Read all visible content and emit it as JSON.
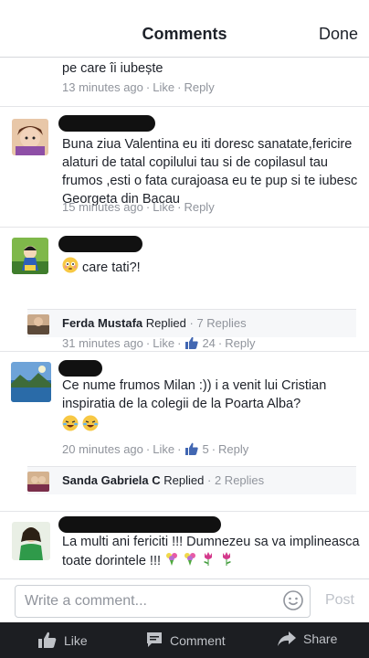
{
  "header": {
    "title": "Comments",
    "done_label": "Done"
  },
  "comments": [
    {
      "text": "pe care îi iubește",
      "time": "13 minutes ago",
      "like": "Like",
      "reply": "Reply"
    },
    {
      "text": "Buna ziua Valentina eu iti doresc sanatate,fericire alaturi de tatal copilului tau si de copilasul tau frumos ,esti o fata curajoasa eu te pup si te iubesc Georgeta din Bacau",
      "time": "15 minutes ago",
      "like": "Like",
      "reply": "Reply"
    },
    {
      "text": "care tati?!",
      "time": "31 minutes ago",
      "like": "Like",
      "likes": "24",
      "reply": "Reply",
      "replies": {
        "name": "Ferda Mustafa",
        "word": "Replied",
        "count": "7 Replies"
      }
    },
    {
      "text": "Ce nume frumos Milan :)) i a venit lui Cristian inspiratia de la colegii de la Poarta Alba?",
      "time": "20 minutes ago",
      "like": "Like",
      "likes": "5",
      "reply": "Reply",
      "replies": {
        "name": "Sanda Gabriela C",
        "word": "Replied",
        "count": "2 Replies"
      }
    },
    {
      "text": "La multi ani fericiti !!! Dumnezeu sa va implineasca toate dorintele !!!"
    }
  ],
  "composer": {
    "placeholder": "Write a comment...",
    "post_label": "Post"
  },
  "tabs": [
    {
      "label": "Like",
      "icon": "thumbs-up-icon"
    },
    {
      "label": "Comment",
      "icon": "comment-icon"
    },
    {
      "label": "Share",
      "icon": "share-icon"
    }
  ],
  "colors": {
    "link_blue": "#4267b2",
    "meta_gray": "#90949c",
    "tabbar_bg": "#1c1e22"
  }
}
